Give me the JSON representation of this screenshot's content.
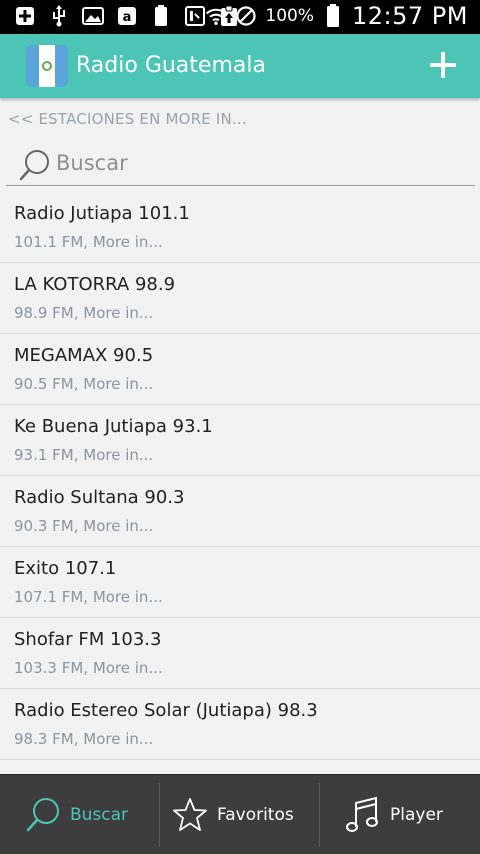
{
  "status_bar": {
    "battery_percent": "100%",
    "time": "12:57 PM"
  },
  "app_bar": {
    "title": "Radio Guatemala"
  },
  "breadcrumb": "<< ESTACIONES EN MORE IN...",
  "search": {
    "placeholder": "Buscar"
  },
  "stations": [
    {
      "name": "Radio Jutiapa 101.1",
      "detail": "101.1 FM, More in..."
    },
    {
      "name": "LA KOTORRA 98.9",
      "detail": "98.9 FM, More in..."
    },
    {
      "name": "MEGAMAX 90.5",
      "detail": "90.5 FM, More in..."
    },
    {
      "name": "Ke Buena Jutiapa 93.1",
      "detail": "93.1 FM, More in..."
    },
    {
      "name": "Radio Sultana 90.3",
      "detail": "90.3 FM, More in..."
    },
    {
      "name": "Exito 107.1",
      "detail": "107.1 FM, More in..."
    },
    {
      "name": "Shofar FM 103.3",
      "detail": "103.3 FM, More in..."
    },
    {
      "name": "Radio Estereo Solar (Jutiapa) 98.3",
      "detail": "98.3 FM, More in..."
    }
  ],
  "bottom_nav": {
    "tabs": [
      {
        "label": "Buscar",
        "icon": "search-icon"
      },
      {
        "label": "Favoritos",
        "icon": "star-icon"
      },
      {
        "label": "Player",
        "icon": "music-note-icon"
      }
    ]
  },
  "colors": {
    "accent": "#4cc5b6",
    "nav_background": "#3d3d3d"
  }
}
